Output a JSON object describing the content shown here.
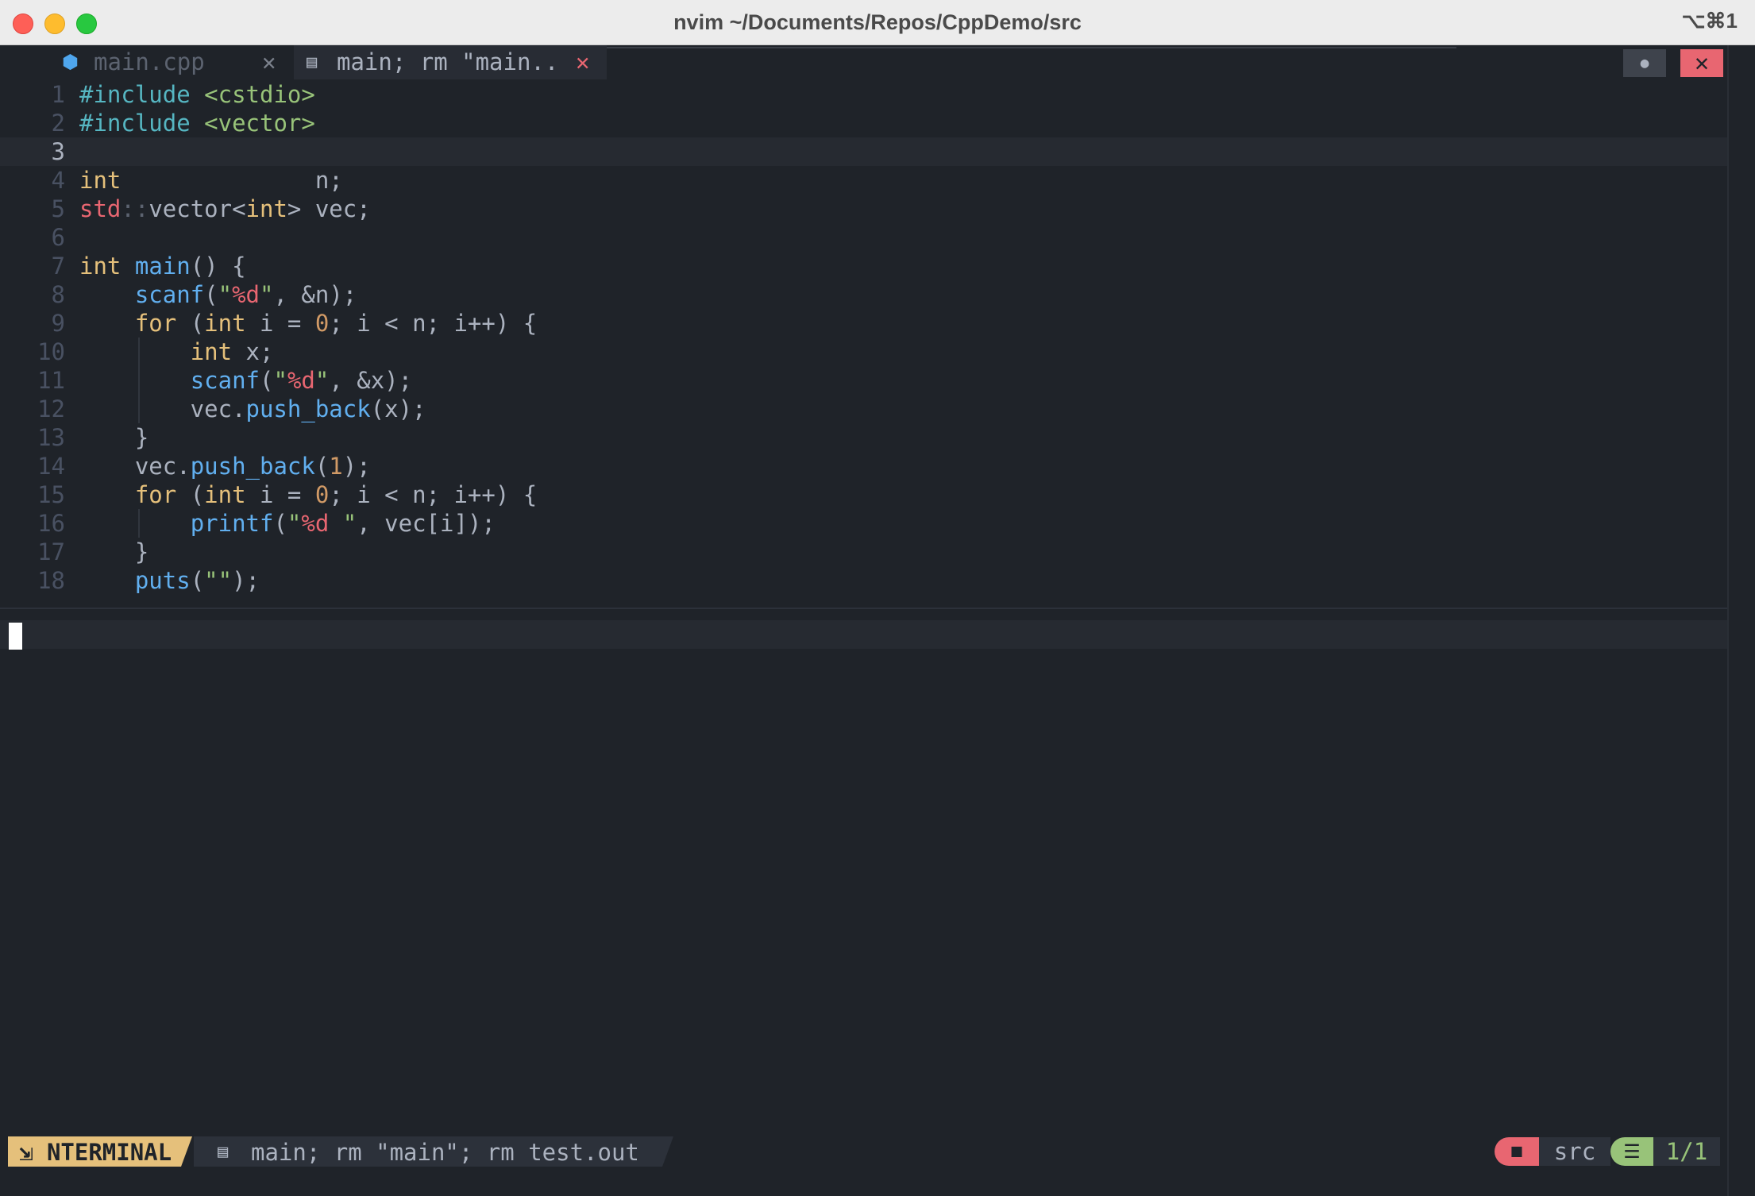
{
  "window": {
    "title": "nvim ~/Documents/Repos/CppDemo/src",
    "shortcut": "⌥⌘1"
  },
  "tabs": [
    {
      "label": "main.cpp",
      "close": "✕",
      "icon": "cpp-file-icon",
      "active": false
    },
    {
      "label": "main; rm \"main..",
      "close": "✕",
      "icon": "terminal-file-icon",
      "active": true
    }
  ],
  "tabline_buttons": {
    "toggle": "●",
    "close": "✕"
  },
  "editor": {
    "current_line": 3,
    "lines": [
      {
        "n": "1",
        "tokens": [
          [
            "#include",
            "pre"
          ],
          [
            " ",
            ""
          ],
          [
            "<cstdio>",
            "str"
          ]
        ]
      },
      {
        "n": "2",
        "tokens": [
          [
            "#include",
            "pre"
          ],
          [
            " ",
            ""
          ],
          [
            "<vector>",
            "str"
          ]
        ]
      },
      {
        "n": "3",
        "tokens": []
      },
      {
        "n": "4",
        "tokens": [
          [
            "int",
            "kw"
          ],
          [
            "              n;",
            ""
          ]
        ]
      },
      {
        "n": "5",
        "tokens": [
          [
            "std",
            "ns"
          ],
          [
            "::",
            "dim"
          ],
          [
            "vector<",
            ""
          ],
          [
            "int",
            "kw"
          ],
          [
            "> vec;",
            ""
          ]
        ]
      },
      {
        "n": "6",
        "tokens": []
      },
      {
        "n": "7",
        "tokens": [
          [
            "int",
            "kw"
          ],
          [
            " ",
            ""
          ],
          [
            "main",
            "fn"
          ],
          [
            "() {",
            ""
          ]
        ]
      },
      {
        "n": "8",
        "tokens": [
          [
            "    ",
            ""
          ],
          [
            "scanf",
            "fn"
          ],
          [
            "(",
            ""
          ],
          [
            "\"",
            "str"
          ],
          [
            "%d",
            "strr"
          ],
          [
            "\"",
            "str"
          ],
          [
            ", &n);",
            ""
          ]
        ]
      },
      {
        "n": "9",
        "tokens": [
          [
            "    ",
            ""
          ],
          [
            "for",
            "kw"
          ],
          [
            " (",
            ""
          ],
          [
            "int",
            "kw"
          ],
          [
            " i = ",
            ""
          ],
          [
            "0",
            "num"
          ],
          [
            "; i < n; i++) {",
            ""
          ]
        ]
      },
      {
        "n": "10",
        "tokens": [
          [
            "        ",
            ""
          ],
          [
            "int",
            "kw"
          ],
          [
            " x;",
            ""
          ]
        ]
      },
      {
        "n": "11",
        "tokens": [
          [
            "        ",
            ""
          ],
          [
            "scanf",
            "fn"
          ],
          [
            "(",
            ""
          ],
          [
            "\"",
            "str"
          ],
          [
            "%d",
            "strr"
          ],
          [
            "\"",
            "str"
          ],
          [
            ", &x);",
            ""
          ]
        ]
      },
      {
        "n": "12",
        "tokens": [
          [
            "        vec.",
            ""
          ],
          [
            "push_back",
            "fn"
          ],
          [
            "(x);",
            ""
          ]
        ]
      },
      {
        "n": "13",
        "tokens": [
          [
            "    }",
            ""
          ]
        ]
      },
      {
        "n": "14",
        "tokens": [
          [
            "    vec.",
            ""
          ],
          [
            "push_back",
            "fn"
          ],
          [
            "(",
            ""
          ],
          [
            "1",
            "num"
          ],
          [
            ");",
            ""
          ]
        ]
      },
      {
        "n": "15",
        "tokens": [
          [
            "    ",
            ""
          ],
          [
            "for",
            "kw"
          ],
          [
            " (",
            ""
          ],
          [
            "int",
            "kw"
          ],
          [
            " i = ",
            ""
          ],
          [
            "0",
            "num"
          ],
          [
            "; i < n; i++) {",
            ""
          ]
        ]
      },
      {
        "n": "16",
        "tokens": [
          [
            "        ",
            ""
          ],
          [
            "printf",
            "fn"
          ],
          [
            "(",
            ""
          ],
          [
            "\"",
            "str"
          ],
          [
            "%d",
            "strr"
          ],
          [
            " \"",
            "str"
          ],
          [
            ", vec[i]);",
            ""
          ]
        ]
      },
      {
        "n": "17",
        "tokens": [
          [
            "    }",
            ""
          ]
        ]
      },
      {
        "n": "18",
        "tokens": [
          [
            "    ",
            ""
          ],
          [
            "puts",
            "fn"
          ],
          [
            "(",
            ""
          ],
          [
            "\"\"",
            "str"
          ],
          [
            ");",
            ""
          ]
        ]
      }
    ]
  },
  "statusline": {
    "mode_icon": "⇲",
    "mode": "NTERMINAL",
    "file_icon": "▤",
    "file": "main; rm \"main\"; rm test.out",
    "folder_icon": "■",
    "dir": "src",
    "pos_icon": "☰",
    "pos": "1/1"
  },
  "colors": {
    "background": "#1f2329",
    "mode_accent": "#e5c07b",
    "folder_accent": "#e86671",
    "position_accent": "#98c379"
  }
}
